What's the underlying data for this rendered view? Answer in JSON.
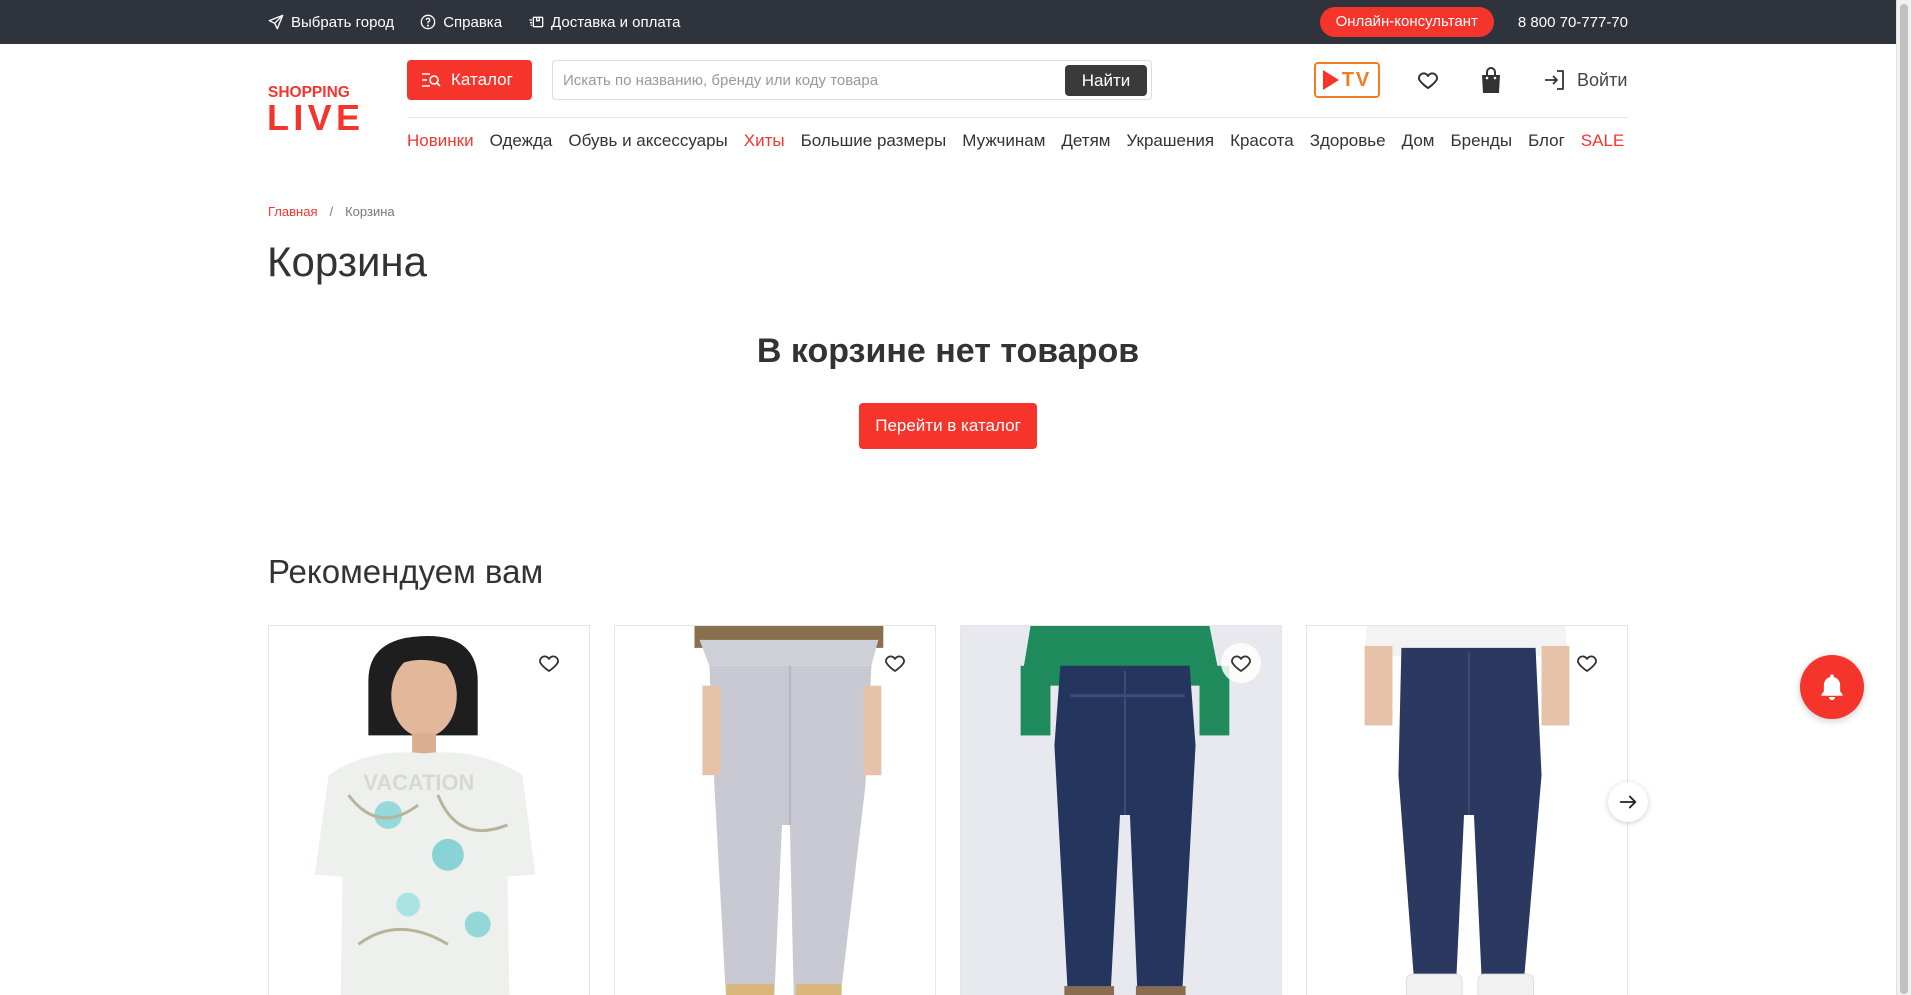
{
  "topbar": {
    "city_label": "Выбрать город",
    "help_label": "Справка",
    "delivery_label": "Доставка и оплата",
    "consultant_label": "Онлайн-консультант",
    "phone": "8 800 70-777-70"
  },
  "logo": {
    "line1": "SHOPPING",
    "line2": "LIVE"
  },
  "header": {
    "catalog_label": "Каталог",
    "search_placeholder": "Искать по названию, бренду или коду товара",
    "search_value": "",
    "search_button": "Найти",
    "tv_label": "TV",
    "login_label": "Войти"
  },
  "nav": [
    {
      "label": "Новинки",
      "highlight": true
    },
    {
      "label": "Одежда",
      "highlight": false
    },
    {
      "label": "Обувь и аксессуары",
      "highlight": false
    },
    {
      "label": "Хиты",
      "highlight": true
    },
    {
      "label": "Большие размеры",
      "highlight": false
    },
    {
      "label": "Мужчинам",
      "highlight": false
    },
    {
      "label": "Детям",
      "highlight": false
    },
    {
      "label": "Украшения",
      "highlight": false
    },
    {
      "label": "Красота",
      "highlight": false
    },
    {
      "label": "Здоровье",
      "highlight": false
    },
    {
      "label": "Дом",
      "highlight": false
    },
    {
      "label": "Бренды",
      "highlight": false
    },
    {
      "label": "Блог",
      "highlight": false
    },
    {
      "label": "SALE",
      "highlight": true
    }
  ],
  "breadcrumb": {
    "home": "Главная",
    "separator": "/",
    "current": "Корзина"
  },
  "page": {
    "title": "Корзина",
    "empty_message": "В корзине нет товаров",
    "catalog_button": "Перейти в каталог",
    "recommend_title": "Рекомендуем вам"
  },
  "colors": {
    "accent": "#f5352c",
    "topbar": "#2f333c",
    "tv": "#f47b20"
  },
  "icons": {
    "city": "send-icon",
    "help": "question-circle-icon",
    "delivery": "delivery-icon",
    "catalog": "search-list-icon",
    "favorites": "heart-icon",
    "cart": "bag-icon",
    "login": "login-icon",
    "next": "arrow-right-icon",
    "notify": "bell-icon"
  }
}
